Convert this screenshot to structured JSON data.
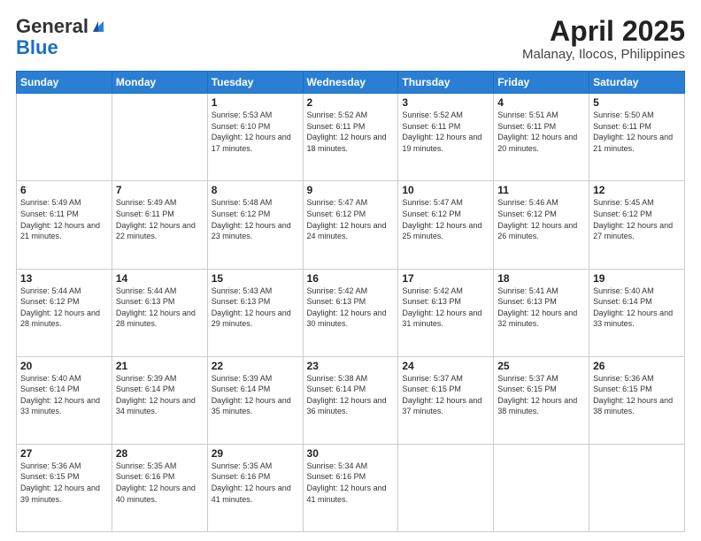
{
  "header": {
    "logo_general": "General",
    "logo_blue": "Blue",
    "title": "April 2025",
    "subtitle": "Malanay, Ilocos, Philippines"
  },
  "days_of_week": [
    "Sunday",
    "Monday",
    "Tuesday",
    "Wednesday",
    "Thursday",
    "Friday",
    "Saturday"
  ],
  "weeks": [
    [
      {
        "day": "",
        "info": ""
      },
      {
        "day": "",
        "info": ""
      },
      {
        "day": "1",
        "info": "Sunrise: 5:53 AM\nSunset: 6:10 PM\nDaylight: 12 hours and 17 minutes."
      },
      {
        "day": "2",
        "info": "Sunrise: 5:52 AM\nSunset: 6:11 PM\nDaylight: 12 hours and 18 minutes."
      },
      {
        "day": "3",
        "info": "Sunrise: 5:52 AM\nSunset: 6:11 PM\nDaylight: 12 hours and 19 minutes."
      },
      {
        "day": "4",
        "info": "Sunrise: 5:51 AM\nSunset: 6:11 PM\nDaylight: 12 hours and 20 minutes."
      },
      {
        "day": "5",
        "info": "Sunrise: 5:50 AM\nSunset: 6:11 PM\nDaylight: 12 hours and 21 minutes."
      }
    ],
    [
      {
        "day": "6",
        "info": "Sunrise: 5:49 AM\nSunset: 6:11 PM\nDaylight: 12 hours and 21 minutes."
      },
      {
        "day": "7",
        "info": "Sunrise: 5:49 AM\nSunset: 6:11 PM\nDaylight: 12 hours and 22 minutes."
      },
      {
        "day": "8",
        "info": "Sunrise: 5:48 AM\nSunset: 6:12 PM\nDaylight: 12 hours and 23 minutes."
      },
      {
        "day": "9",
        "info": "Sunrise: 5:47 AM\nSunset: 6:12 PM\nDaylight: 12 hours and 24 minutes."
      },
      {
        "day": "10",
        "info": "Sunrise: 5:47 AM\nSunset: 6:12 PM\nDaylight: 12 hours and 25 minutes."
      },
      {
        "day": "11",
        "info": "Sunrise: 5:46 AM\nSunset: 6:12 PM\nDaylight: 12 hours and 26 minutes."
      },
      {
        "day": "12",
        "info": "Sunrise: 5:45 AM\nSunset: 6:12 PM\nDaylight: 12 hours and 27 minutes."
      }
    ],
    [
      {
        "day": "13",
        "info": "Sunrise: 5:44 AM\nSunset: 6:12 PM\nDaylight: 12 hours and 28 minutes."
      },
      {
        "day": "14",
        "info": "Sunrise: 5:44 AM\nSunset: 6:13 PM\nDaylight: 12 hours and 28 minutes."
      },
      {
        "day": "15",
        "info": "Sunrise: 5:43 AM\nSunset: 6:13 PM\nDaylight: 12 hours and 29 minutes."
      },
      {
        "day": "16",
        "info": "Sunrise: 5:42 AM\nSunset: 6:13 PM\nDaylight: 12 hours and 30 minutes."
      },
      {
        "day": "17",
        "info": "Sunrise: 5:42 AM\nSunset: 6:13 PM\nDaylight: 12 hours and 31 minutes."
      },
      {
        "day": "18",
        "info": "Sunrise: 5:41 AM\nSunset: 6:13 PM\nDaylight: 12 hours and 32 minutes."
      },
      {
        "day": "19",
        "info": "Sunrise: 5:40 AM\nSunset: 6:14 PM\nDaylight: 12 hours and 33 minutes."
      }
    ],
    [
      {
        "day": "20",
        "info": "Sunrise: 5:40 AM\nSunset: 6:14 PM\nDaylight: 12 hours and 33 minutes."
      },
      {
        "day": "21",
        "info": "Sunrise: 5:39 AM\nSunset: 6:14 PM\nDaylight: 12 hours and 34 minutes."
      },
      {
        "day": "22",
        "info": "Sunrise: 5:39 AM\nSunset: 6:14 PM\nDaylight: 12 hours and 35 minutes."
      },
      {
        "day": "23",
        "info": "Sunrise: 5:38 AM\nSunset: 6:14 PM\nDaylight: 12 hours and 36 minutes."
      },
      {
        "day": "24",
        "info": "Sunrise: 5:37 AM\nSunset: 6:15 PM\nDaylight: 12 hours and 37 minutes."
      },
      {
        "day": "25",
        "info": "Sunrise: 5:37 AM\nSunset: 6:15 PM\nDaylight: 12 hours and 38 minutes."
      },
      {
        "day": "26",
        "info": "Sunrise: 5:36 AM\nSunset: 6:15 PM\nDaylight: 12 hours and 38 minutes."
      }
    ],
    [
      {
        "day": "27",
        "info": "Sunrise: 5:36 AM\nSunset: 6:15 PM\nDaylight: 12 hours and 39 minutes."
      },
      {
        "day": "28",
        "info": "Sunrise: 5:35 AM\nSunset: 6:16 PM\nDaylight: 12 hours and 40 minutes."
      },
      {
        "day": "29",
        "info": "Sunrise: 5:35 AM\nSunset: 6:16 PM\nDaylight: 12 hours and 41 minutes."
      },
      {
        "day": "30",
        "info": "Sunrise: 5:34 AM\nSunset: 6:16 PM\nDaylight: 12 hours and 41 minutes."
      },
      {
        "day": "",
        "info": ""
      },
      {
        "day": "",
        "info": ""
      },
      {
        "day": "",
        "info": ""
      }
    ]
  ]
}
